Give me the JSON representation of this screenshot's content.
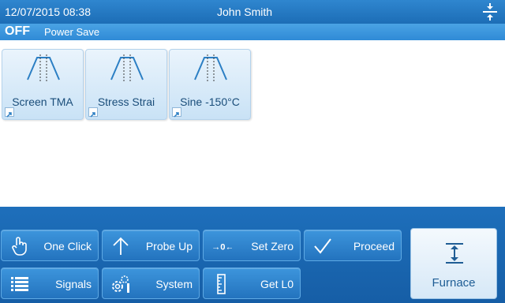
{
  "header": {
    "datetime": "12/07/2015 08:38",
    "user": "John Smith",
    "split_icon": "split-vertical-icon"
  },
  "status": {
    "state": "OFF",
    "mode": "Power Save"
  },
  "methods": [
    {
      "label": "Screen TMA",
      "icon": "temperature-program-icon"
    },
    {
      "label": "Stress Strai",
      "icon": "temperature-program-icon"
    },
    {
      "label": "Sine -150°C",
      "icon": "temperature-program-icon"
    }
  ],
  "buttons": {
    "one_click": "One Click",
    "probe_up": "Probe Up",
    "set_zero": "Set Zero",
    "proceed": "Proceed",
    "signals": "Signals",
    "system": "System",
    "get_l0": "Get L0",
    "furnace": "Furnace"
  },
  "colors": {
    "header": "#1c6db6",
    "statusbar": "#2f8ad6",
    "bottom_panel": "#165ea6",
    "tile": "#c9e2f6"
  }
}
